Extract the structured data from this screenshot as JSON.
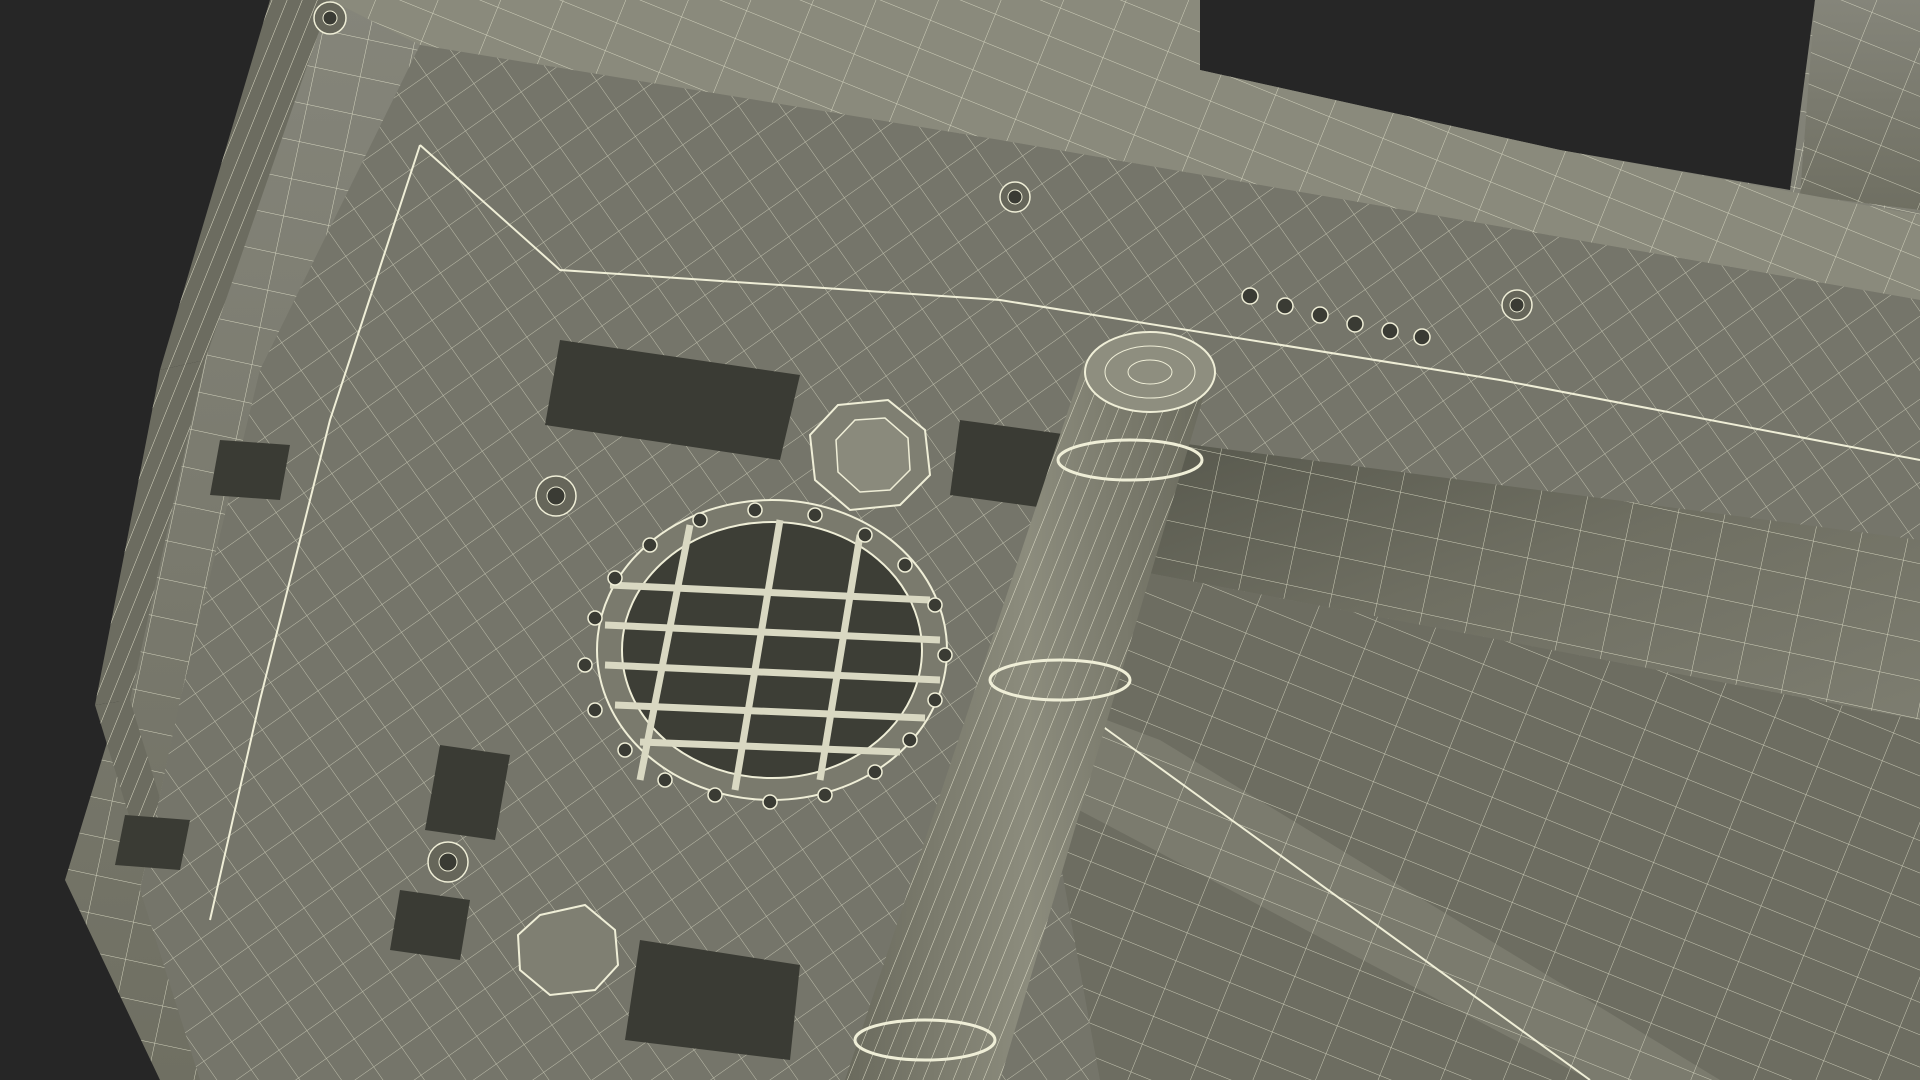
{
  "scene": {
    "subject": "wireframe-3d-model",
    "background_color": "#262626",
    "surface_color": "#7b7b6d",
    "surface_dark_color": "#5e5f53",
    "surface_light_color": "#8a8a7b",
    "wire_color": "#efeed7",
    "icons": [
      "screw-hole-icon",
      "vent-grille-icon",
      "round-foot-icon"
    ]
  }
}
